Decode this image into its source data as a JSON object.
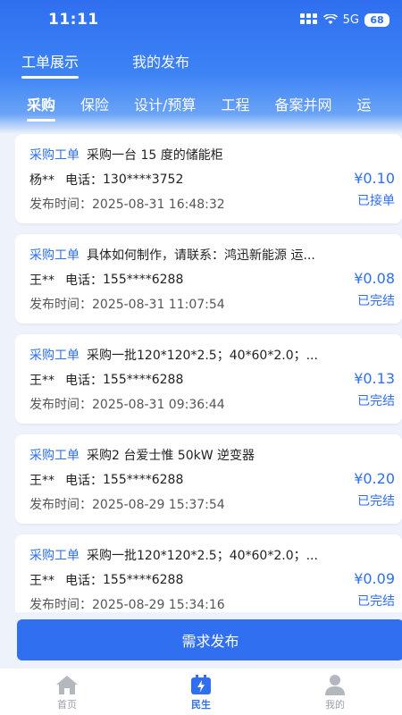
{
  "status_bar": {
    "time": "11:11",
    "network": "5G",
    "battery": "68"
  },
  "top_tabs": [
    {
      "label": "工单展示",
      "active": true
    },
    {
      "label": "我的发布",
      "active": false
    }
  ],
  "category_tabs": [
    {
      "label": "采购",
      "active": true
    },
    {
      "label": "保险",
      "active": false
    },
    {
      "label": "设计/预算",
      "active": false
    },
    {
      "label": "工程",
      "active": false
    },
    {
      "label": "备案并网",
      "active": false
    },
    {
      "label": "运",
      "active": false
    }
  ],
  "orders": [
    {
      "tag": "采购工单",
      "title": "采购一台 15 度的储能柜",
      "name": "杨**",
      "phone_label": "电话：",
      "phone": "130****3752",
      "time_label": "发布时间：",
      "time": "2025-08-31 16:48:32",
      "price": "¥0.10",
      "status": "已接单"
    },
    {
      "tag": "采购工单",
      "title": "具体如何制作，请联系：鸿迅新能源 运...",
      "name": "王**",
      "phone_label": "电话：",
      "phone": "155****6288",
      "time_label": "发布时间：",
      "time": "2025-08-31 11:07:54",
      "price": "¥0.08",
      "status": "已完结"
    },
    {
      "tag": "采购工单",
      "title": "采购一批120*120*2.5；40*60*2.0；...",
      "name": "王**",
      "phone_label": "电话：",
      "phone": "155****6288",
      "time_label": "发布时间：",
      "time": "2025-08-31 09:36:44",
      "price": "¥0.13",
      "status": "已完结"
    },
    {
      "tag": "采购工单",
      "title": "采购2 台爱士惟 50kW 逆变器",
      "name": "王**",
      "phone_label": "电话：",
      "phone": "155****6288",
      "time_label": "发布时间：",
      "time": "2025-08-29 15:37:54",
      "price": "¥0.20",
      "status": "已完结"
    },
    {
      "tag": "采购工单",
      "title": "采购一批120*120*2.5；40*60*2.0；...",
      "name": "王**",
      "phone_label": "电话：",
      "phone": "155****6288",
      "time_label": "发布时间：",
      "time": "2025-08-29 15:34:16",
      "price": "¥0.09",
      "status": "已完结"
    }
  ],
  "publish_button": "需求发布",
  "bottom_nav": [
    {
      "label": "首页",
      "icon": "home-icon",
      "active": false
    },
    {
      "label": "民生",
      "icon": "livelihood-icon",
      "active": true
    },
    {
      "label": "我的",
      "icon": "profile-icon",
      "active": false
    }
  ],
  "colors": {
    "accent": "#2f6ff0",
    "background": "#eef3fb"
  }
}
